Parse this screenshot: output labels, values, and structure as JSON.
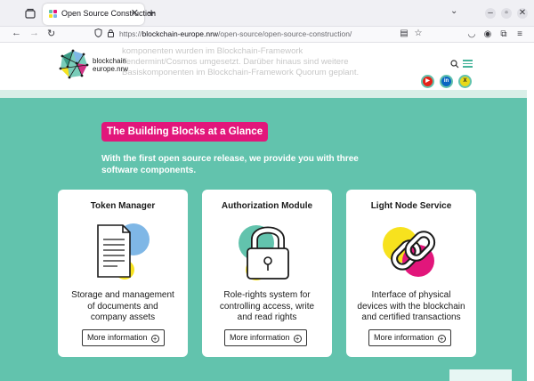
{
  "browser": {
    "tab_title": "Open Source Construction",
    "tab_close": "✕",
    "new_tab": "+",
    "url_prefix": "https://",
    "url_domain": "blockchain-europe.nrw",
    "url_path": "/open-source/open-source-construction/",
    "icons": [
      "tab-list-icon",
      "back-arrow-icon",
      "forward-arrow-icon",
      "reload-icon",
      "shield-icon",
      "lock-icon",
      "reader-view-icon",
      "bookmark-star-icon",
      "pocket-icon",
      "account-icon",
      "extensions-icon",
      "menu-icon",
      "minimize-icon",
      "maximize-icon",
      "close-icon",
      "chevron-down-icon"
    ]
  },
  "header": {
    "ghost_text": "komponenten wurden im Blockchain-Framework Tendermint/Cosmos umgesetzt. Darüber hinaus sind weitere Basiskomponenten im Blockchain-Framework Quorum geplant.",
    "logo_line1": "blockchain",
    "logo_line2": "europe.nrw",
    "social": [
      {
        "name": "youtube",
        "label": "▶",
        "color": "#e62117"
      },
      {
        "name": "linkedin",
        "label": "in",
        "color": "#0a66c2"
      },
      {
        "name": "x",
        "label": "X",
        "color": "#e8d81a"
      }
    ]
  },
  "main": {
    "headline": "The Building Blocks at a Glance",
    "intro": "With the first open source release, we provide you with three software components.",
    "cards": [
      {
        "title": "Token Manager",
        "desc_line1": "Storage and management",
        "desc_line2": "of documents and",
        "desc_line3": "company assets",
        "button": "More information",
        "icon": "document-icon"
      },
      {
        "title": "Authorization Module",
        "desc_line1": "Role-rights system for",
        "desc_line2": "controlling access, write",
        "desc_line3": "and read rights",
        "button": "More information",
        "icon": "padlock-icon"
      },
      {
        "title": "Light Node Service",
        "desc_line1": "Interface of physical",
        "desc_line2": "devices with the blockchain",
        "desc_line3": "and certified transactions",
        "button": "More information",
        "icon": "chain-link-icon"
      }
    ]
  },
  "colors": {
    "teal": "#62c3ad",
    "magenta": "#e2167b",
    "yellow": "#f7e21e",
    "blue": "#7fb7e6",
    "dark_teal": "#3a9a84"
  }
}
